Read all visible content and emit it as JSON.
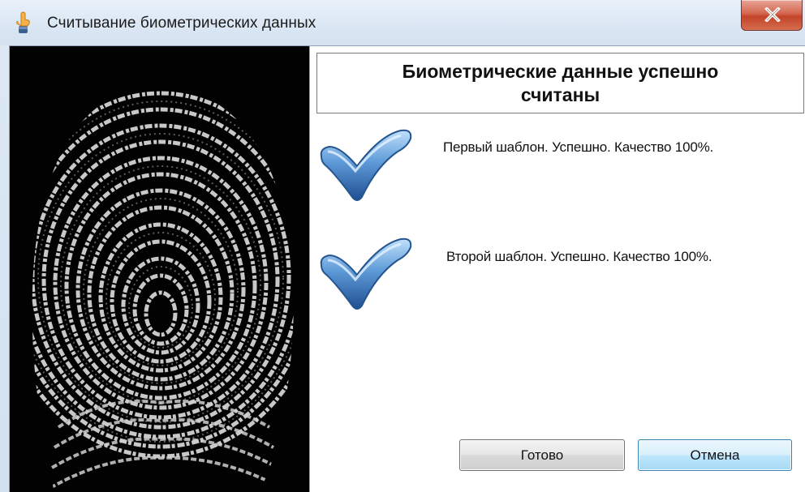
{
  "window": {
    "title": "Считывание биометрических данных"
  },
  "status": {
    "heading": "Биометрические данные успешно считаны"
  },
  "results": [
    {
      "text": "Первый шаблон. Успешно. Качество 100%."
    },
    {
      "text": "Второй шаблон. Успешно. Качество 100%."
    }
  ],
  "buttons": {
    "ok_label": "Готово",
    "cancel_label": "Отмена"
  },
  "icons": {
    "app": "finger-pointer-icon",
    "close": "close-x-icon",
    "check": "checkmark-icon",
    "fingerprint": "fingerprint-image"
  },
  "colors": {
    "close_red": "#c24428",
    "check_blue": "#2f6fb5",
    "cancel_blue": "#3c7fb1"
  }
}
